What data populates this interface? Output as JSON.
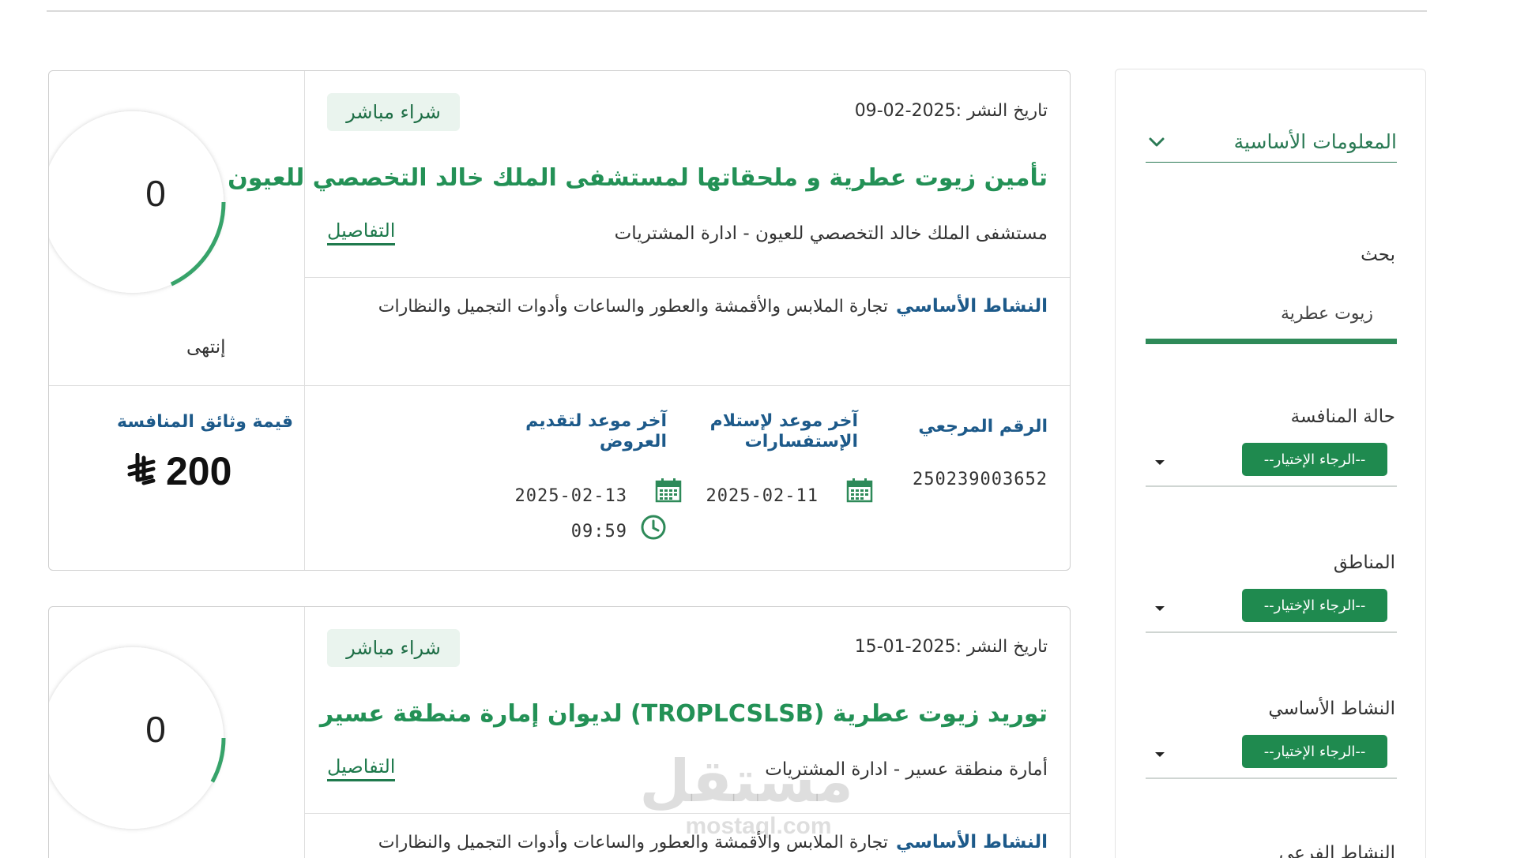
{
  "sidebar": {
    "header_title": "المعلومات الأساسية",
    "search_label": "بحث",
    "search_value": "زيوت عطرية",
    "filters": [
      {
        "label": "حالة المنافسة",
        "placeholder": "--الرجاء الإختيار--"
      },
      {
        "label": "المناطق",
        "placeholder": "--الرجاء الإختيار--"
      },
      {
        "label": "النشاط الأساسي",
        "placeholder": "--الرجاء الإختيار--"
      },
      {
        "label": "النشاط الفرعي"
      }
    ]
  },
  "tenders": [
    {
      "tag": "شراء مباشر",
      "published": "تاريخ النشر :2025-02-09",
      "title": "تأمين زيوت عطرية و ملحقاتها لمستشفى الملك خالد التخصصي للعيون",
      "org": "مستشفى الملك خالد التخصصي للعيون - ادارة المشتريات",
      "details_label": "التفاصيل",
      "activity_label": "النشاط الأساسي",
      "activity_value": "تجارة الملابس والأقمشة والعطور والساعات وأدوات التجميل والنظارات",
      "ref_label": "الرقم المرجعي",
      "ref_value": "250239003652",
      "inquiry_label": "آخر موعد لإستلام الإستفسارات",
      "inquiry_date": "2025-02-11",
      "offers_label": "آخر موعد لتقديم العروض",
      "offers_date": "2025-02-13",
      "offers_time": "09:59",
      "gauge_value": "0",
      "gauge_fraction": 0.18,
      "status": "إنتهى",
      "price_label": "قيمة وثائق المنافسة",
      "price_value": "200"
    },
    {
      "tag": "شراء مباشر",
      "published": "تاريخ النشر :2025-01-15",
      "title": "توريد زيوت عطرية (TROPLCSLSB) لديوان إمارة منطقة عسير",
      "org": "أمارة منطقة عسير - ادارة المشتريات",
      "details_label": "التفاصيل",
      "activity_label": "النشاط الأساسي",
      "activity_value": "تجارة الملابس والأقمشة والعطور والساعات وأدوات التجميل والنظارات",
      "gauge_value": "0",
      "gauge_fraction": 0.08
    }
  ],
  "watermark": {
    "arabic": "مستقل",
    "latin": "mostaql.com"
  },
  "colors": {
    "brand_green": "#239156",
    "label_blue": "#1d5a8a",
    "pill_green": "#1f8a4f"
  }
}
